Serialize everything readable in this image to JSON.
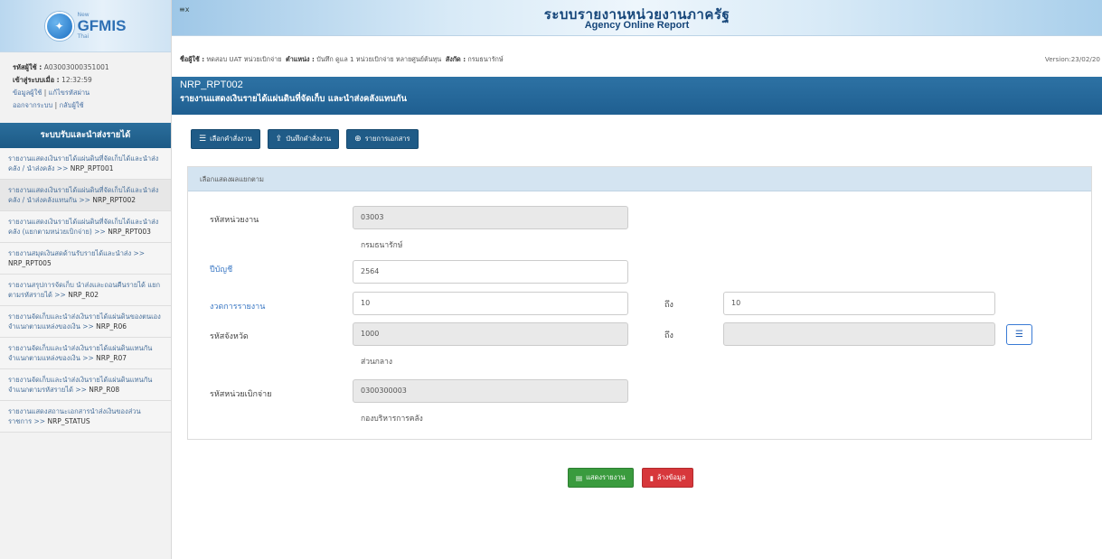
{
  "logo": {
    "new": "New",
    "name": "GFMIS",
    "sub": "Thai"
  },
  "user_info": {
    "user_id_label": "รหัสผู้ใช้ :",
    "user_id": "A03003000351001",
    "login_time_label": "เข้าสู่ระบบเมื่อ :",
    "login_time": "12:32:59",
    "profile_link": "ข้อมูลผู้ใช้",
    "change_password_link": "แก้ไขรหัสผ่าน",
    "logout_link": "ออกจากระบบ",
    "back_link": "กลับผู้ใช้"
  },
  "sidebar": {
    "header": "ระบบรับและนำส่งรายได้",
    "items": [
      {
        "text": "รายงานแสดงเงินรายได้แผ่นดินที่จัดเก็บได้และนำส่งคลัง / นำส่งคลัง >> ",
        "code": "NRP_RPT001"
      },
      {
        "text": "รายงานแสดงเงินรายได้แผ่นดินที่จัดเก็บได้และนำส่งคลัง / นำส่งคลังแทนกัน >> ",
        "code": "NRP_RPT002"
      },
      {
        "text": "รายงานแสดงเงินรายได้แผ่นดินที่จัดเก็บได้และนำส่งคลัง (แยกตามหน่วยเบิกจ่าย) >> ",
        "code": "NRP_RPT003"
      },
      {
        "text": "รายงานสมุดเงินสดด้านรับรายได้และนำส่ง >> ",
        "code": "NRP_RPT005"
      },
      {
        "text": "รายงานสรุปการจัดเก็บ นำส่งและถอนคืนรายได้ แยกตามรหัสรายได้ >> ",
        "code": "NRP_R02"
      },
      {
        "text": "รายงานจัดเก็บและนำส่งเงินรายได้แผ่นดินของตนเอง จำแนกตามแหล่งของเงิน >> ",
        "code": "NRP_R06"
      },
      {
        "text": "รายงานจัดเก็บและนำส่งเงินรายได้แผ่นดินแทนกัน จำแนกตามแหล่งของเงิน >> ",
        "code": "NRP_R07"
      },
      {
        "text": "รายงานจัดเก็บและนำส่งเงินรายได้แผ่นดินแทนกัน จำแนกตามรหัสรายได้ >> ",
        "code": "NRP_R08"
      },
      {
        "text": "รายงานแสดงสถานะเอกสารนำส่งเงินของส่วนราชการ >> ",
        "code": "NRP_STATUS"
      }
    ]
  },
  "banner": {
    "collapse_icon": "≡x",
    "title": "ระบบรายงานหน่วยงานภาครัฐ",
    "subtitle": "Agency Online Report"
  },
  "userbar": {
    "user_label": "ชื่อผู้ใช้ :",
    "user": "ทดสอบ UAT หน่วยเบิกจ่าย",
    "position_label": "ตำแหน่ง :",
    "position": "บันทึก ดูแล 1 หน่วยเบิกจ่าย หลายศูนย์ต้นทุน",
    "dept_label": "สังกัด :",
    "dept": "กรมธนารักษ์",
    "version": "Version:23/02/20"
  },
  "page": {
    "code": "NRP_RPT002",
    "title": "รายงานแสดงเงินรายได้แผ่นดินที่จัดเก็บ และนำส่งคลังแทนกัน"
  },
  "toolbar": {
    "select_label": "เลือกคำสั่งงาน",
    "save_label": "บันทึกคำสั่งงาน",
    "docs_label": "รายการเอกสาร"
  },
  "panel": {
    "header": "เลือกแสดงผลแยกตาม"
  },
  "form": {
    "agency_label": "รหัสหน่วยงาน",
    "agency_value": "03003",
    "agency_name": "กรมธนารักษ์",
    "fiscal_year_label": "ปีบัญชี",
    "fiscal_year_value": "2564",
    "period_label": "งวดการรายงาน",
    "period_from": "10",
    "to_label": "ถึง",
    "period_to": "10",
    "province_label": "รหัสจังหวัด",
    "province_value": "1000",
    "province_to_label": "ถึง",
    "province_to": "",
    "province_name": "ส่วนกลาง",
    "disb_label": "รหัสหน่วยเบิกจ่าย",
    "disb_value": "0300300003",
    "disb_name": "กองบริหารการคลัง"
  },
  "actions": {
    "show_label": "แสดงรายงาน",
    "clear_label": "ล้างข้อมูล"
  },
  "colors": {
    "primary": "#1f5b87",
    "header_band": "#2d72a4",
    "green": "#3a9b3e",
    "red": "#d7373b"
  }
}
